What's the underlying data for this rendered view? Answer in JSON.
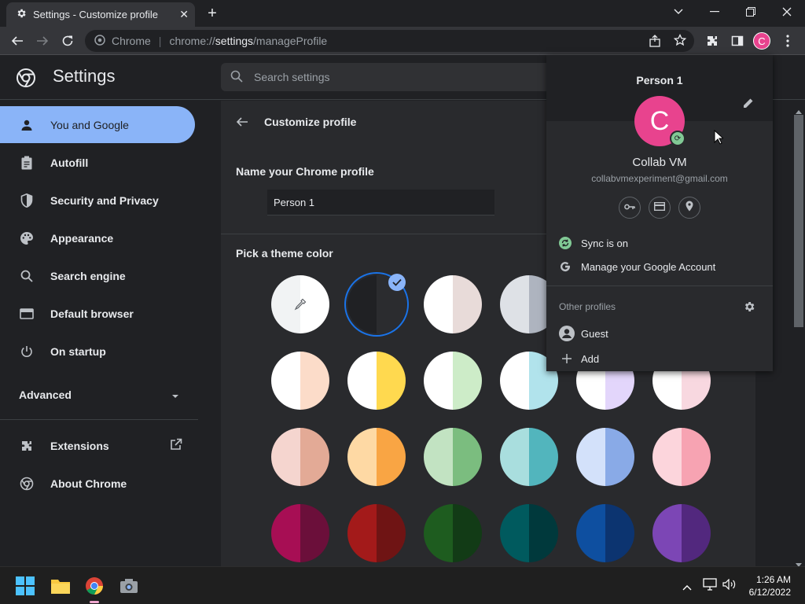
{
  "tab": {
    "title": "Settings - Customize profile",
    "icon": "gear-icon"
  },
  "window_controls": {
    "dropdown": "chevron-down-icon",
    "minimize": "minimize-icon",
    "restore": "restore-icon",
    "close": "close-icon"
  },
  "omnibox": {
    "origin": "Chrome",
    "url_prefix": "chrome://",
    "url_host": "settings",
    "url_path": "/manageProfile"
  },
  "toolbar": {
    "avatar_letter": "C"
  },
  "settings": {
    "title": "Settings",
    "search_placeholder": "Search settings"
  },
  "sidebar": {
    "items": [
      {
        "label": "You and Google",
        "icon": "person-icon",
        "active": true
      },
      {
        "label": "Autofill",
        "icon": "clipboard-icon"
      },
      {
        "label": "Security and Privacy",
        "icon": "shield-icon"
      },
      {
        "label": "Appearance",
        "icon": "palette-icon"
      },
      {
        "label": "Search engine",
        "icon": "search-icon"
      },
      {
        "label": "Default browser",
        "icon": "browser-icon"
      },
      {
        "label": "On startup",
        "icon": "power-icon"
      }
    ],
    "advanced": "Advanced",
    "extensions": "Extensions",
    "about": "About Chrome"
  },
  "customize": {
    "title": "Customize profile",
    "name_label": "Name your Chrome profile",
    "name_value": "Person 1",
    "theme_label": "Pick a theme color",
    "swatches": [
      [
        "#f1f3f4",
        "#ffffff"
      ],
      [
        "#202124",
        "#2b2c2f"
      ],
      [
        "#ffffff",
        "#e8dbd9"
      ],
      [
        "#dee1e6",
        "#aeb4bf"
      ],
      [
        "#ffffff",
        "#fcdcc9"
      ],
      [
        "#ffffff",
        "#ffd94f"
      ],
      [
        "#ffffff",
        "#cdecc8"
      ],
      [
        "#ffffff",
        "#b1e3ec"
      ],
      [
        "#ffffff",
        "#e3d6fb"
      ],
      [
        "#ffffff",
        "#f8d8e0"
      ],
      [
        "#f5d5cf",
        "#e3aa96"
      ],
      [
        "#fed9a4",
        "#f9a544"
      ],
      [
        "#c2e3c2",
        "#7bbd7f"
      ],
      [
        "#a9dede",
        "#52b5bd"
      ],
      [
        "#d3e1fa",
        "#89aae7"
      ],
      [
        "#fcd5dc",
        "#f7a3b2"
      ],
      [
        "#a70e54",
        "#6b0f3a"
      ],
      [
        "#a31a1a",
        "#6f1414"
      ],
      [
        "#1e5c1f",
        "#123b16"
      ],
      [
        "#005a5e",
        "#00393c"
      ],
      [
        "#0e4fa0",
        "#0c3470"
      ],
      [
        "#7c46b5",
        "#52287e"
      ]
    ]
  },
  "profile_popup": {
    "person": "Person 1",
    "avatar_letter": "C",
    "name": "Collab VM",
    "email": "collabvmexperiment@gmail.com",
    "sync": "Sync is on",
    "manage": "Manage your Google Account",
    "other_profiles": "Other profiles",
    "guest": "Guest",
    "add": "Add"
  },
  "taskbar": {
    "time": "1:26 AM",
    "date": "6/12/2022"
  },
  "colors": {
    "accent": "#8ab4f8",
    "avatar": "#e8438e",
    "sync_green": "#81c995"
  }
}
